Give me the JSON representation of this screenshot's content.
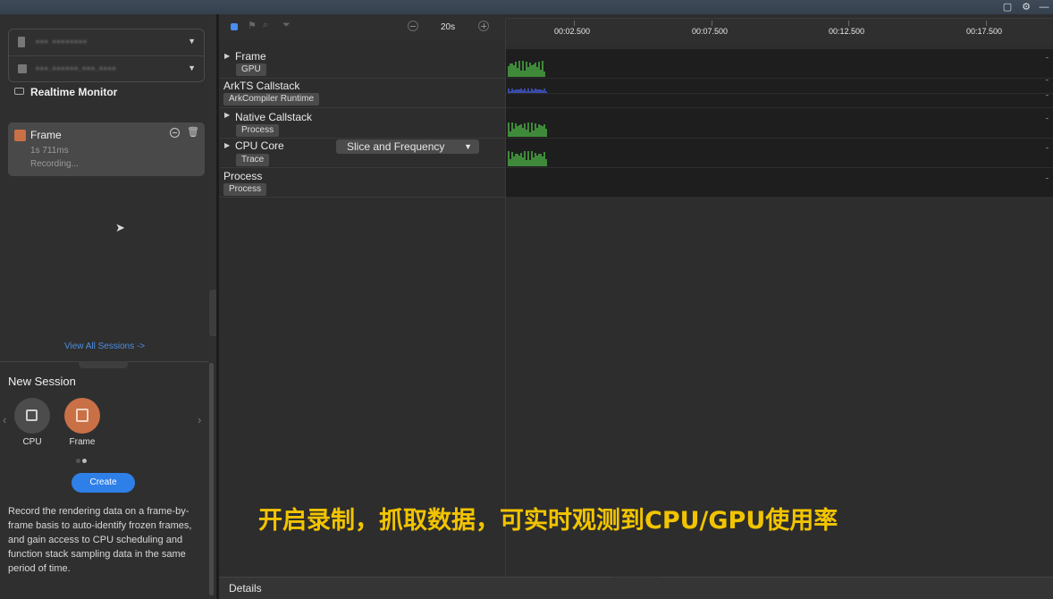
{
  "window": {
    "controls": [
      "restore-icon",
      "settings-icon",
      "minimize-icon"
    ]
  },
  "left_panel": {
    "realtime_monitor": "Realtime Monitor",
    "session": {
      "name": "Frame",
      "duration": "1s 711ms",
      "status": "Recording..."
    },
    "view_all": "View All Sessions ->",
    "new_session": "New Session",
    "options": [
      {
        "label": "CPU"
      },
      {
        "label": "Frame"
      }
    ],
    "create": "Create",
    "description": "Record the rendering data on a frame-by-frame basis to auto-identify frozen frames, and gain access to CPU scheduling and function stack sampling data in the same period of time."
  },
  "toolbar": {
    "zoom": "20s"
  },
  "timeline": {
    "ticks": [
      "00:02.500",
      "00:07.500",
      "00:12.500",
      "00:17.500"
    ]
  },
  "tracks": [
    {
      "name": "Frame",
      "tag": "GPU",
      "status": "recording",
      "expandable": true
    },
    {
      "name": "ArkTS Callstack",
      "tag": "ArkCompiler Runtime",
      "status": "recording",
      "status2": "recording",
      "expandable": false
    },
    {
      "name": "Native Callstack",
      "tag": "Process",
      "status": "recording",
      "expandable": true
    },
    {
      "name": "CPU Core",
      "tag": "Trace",
      "status": "recording",
      "expandable": true
    },
    {
      "name": "Process",
      "tag": "Process",
      "status": "recording",
      "expandable": false
    }
  ],
  "cpu_core_select": "Slice and Frequency",
  "caption": "开启录制，抓取数据，可实时观测到CPU/GPU使用率",
  "details": "Details",
  "colors": {
    "accent": "#2f7fe8",
    "frame": "#c97046",
    "caption": "#f2c400",
    "bar_green": "#3f8a3a",
    "bar_blue": "#3a4aa8"
  }
}
